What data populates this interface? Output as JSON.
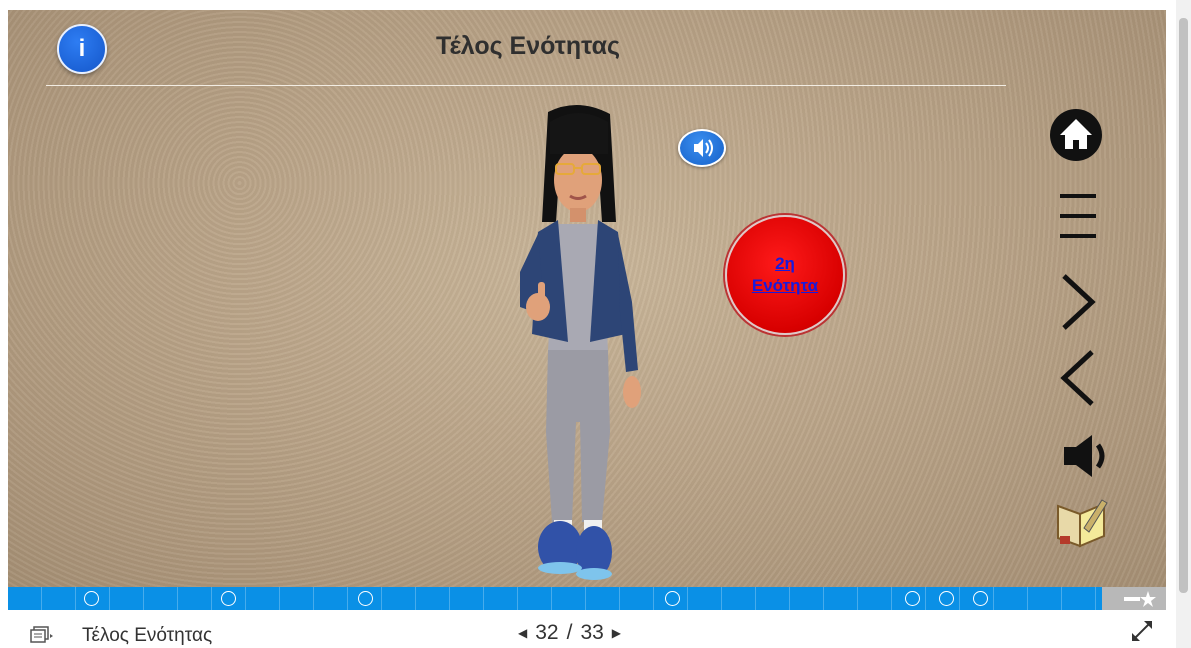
{
  "slide": {
    "title": "Τέλος Ενότητας",
    "info_icon_glyph": "i",
    "audio_icon": "speaker-icon",
    "next_section_button": {
      "line1": "2η",
      "line2": "Ενότητα",
      "color": "#e00000",
      "text_color": "#1a1adb"
    }
  },
  "side_nav": {
    "home_icon": "home-icon",
    "menu_icon": "menu-icon",
    "next_icon": "chevron-right-icon",
    "prev_icon": "chevron-left-icon",
    "sound_icon": "speaker-icon",
    "notebook_icon": "notebook-icon"
  },
  "progress": {
    "color": "#0a90e6",
    "current": 32,
    "total": 33
  },
  "footer": {
    "slide_title": "Τέλος Ενότητας",
    "page_current": "32",
    "page_separator": "/",
    "page_total": "33",
    "prev_glyph": "◀",
    "next_glyph": "▶"
  }
}
